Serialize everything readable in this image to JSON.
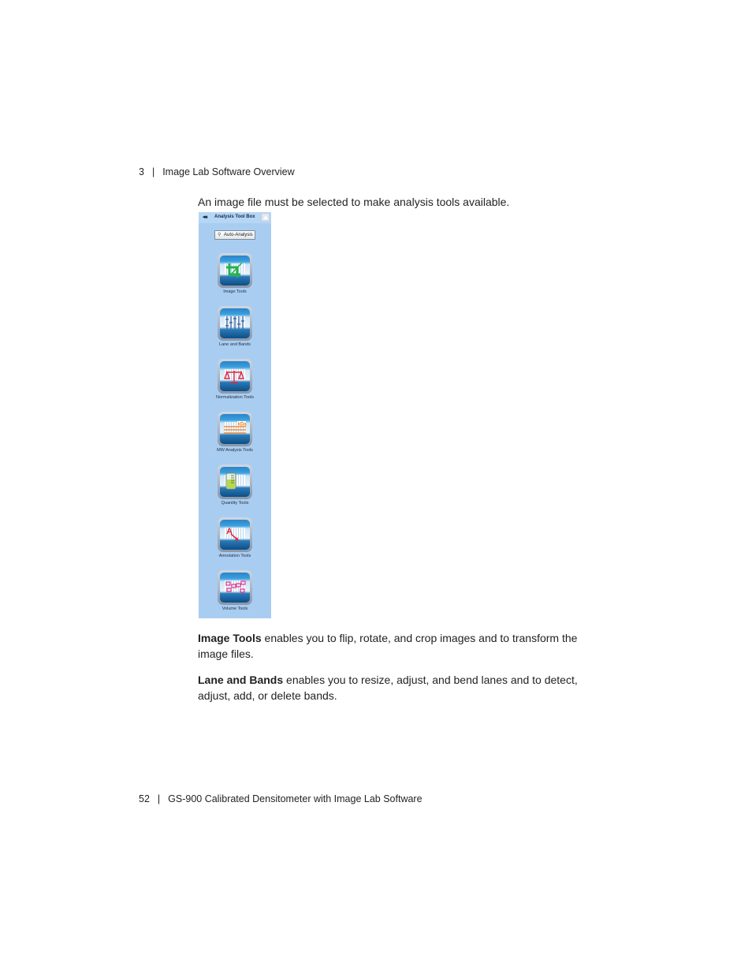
{
  "header": {
    "chapter_number": "3",
    "separator": "|",
    "chapter_title": "Image Lab Software Overview"
  },
  "intro_text": "An image file must be selected to make analysis tools available.",
  "toolbox": {
    "collapse_icon": "double-chevron-left-icon",
    "title": "Analysis Tool Box",
    "pin_icon": "pin-up-icon",
    "auto_analysis_label": "Auto-Analysis",
    "auto_analysis_icon": "magic-wand-icon",
    "tools": [
      {
        "label": "Image Tools",
        "icon": "crop-icon"
      },
      {
        "label": "Lane and Bands",
        "icon": "lanes-bands-icon"
      },
      {
        "label": "Normalization Tools",
        "icon": "balance-scale-icon"
      },
      {
        "label": "MW Analysis Tools",
        "icon": "kda-ruler-icon"
      },
      {
        "label": "Quantity Tools",
        "icon": "beaker-icon"
      },
      {
        "label": "Annotation Tools",
        "icon": "text-arrow-icon"
      },
      {
        "label": "Volume Tools",
        "icon": "volume-boxes-icon"
      }
    ],
    "colors": {
      "panel_bg": "#a9cdf1",
      "accent_crop": "#22b24c",
      "accent_red": "#e8243c",
      "accent_orange": "#f07c1e",
      "accent_pink": "#e0338c"
    }
  },
  "paragraphs": [
    {
      "term": "Image Tools",
      "text": " enables you to flip, rotate, and crop images and to transform the image files."
    },
    {
      "term": "Lane and Bands",
      "text": " enables you to resize, adjust, and bend lanes and to detect, adjust, add, or delete bands."
    }
  ],
  "footer": {
    "page_number": "52",
    "separator": "|",
    "book_title": "GS-900 Calibrated Densitometer with Image Lab Software"
  }
}
